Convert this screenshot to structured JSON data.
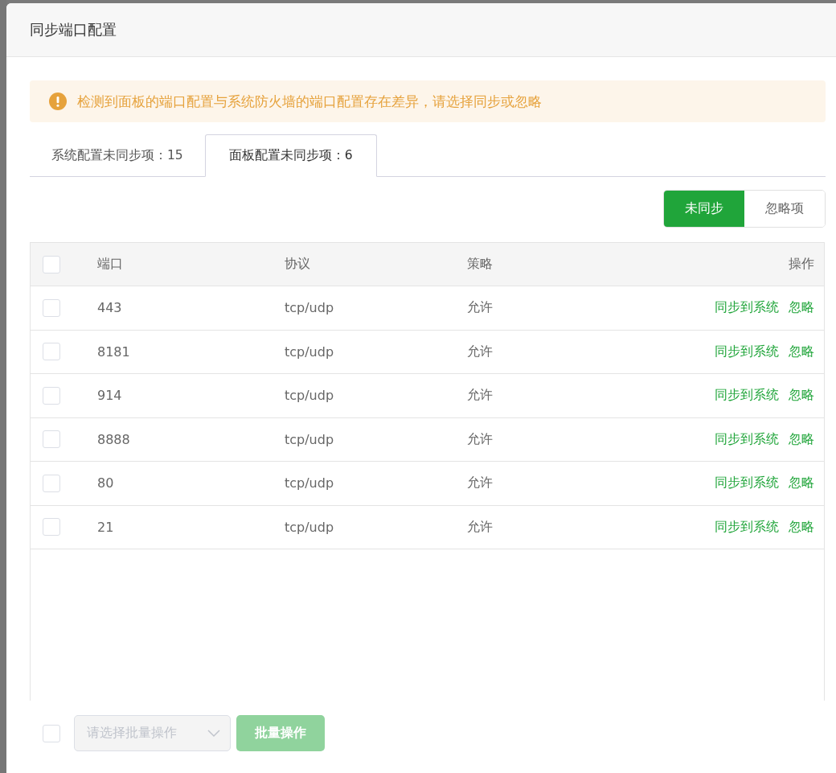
{
  "dialog": {
    "title": "同步端口配置"
  },
  "alert": {
    "text": "检测到面板的端口配置与系统防火墙的端口配置存在差异，请选择同步或忽略"
  },
  "tabs": [
    {
      "label": "系统配置未同步项：15",
      "selected": false
    },
    {
      "label": "面板配置未同步项：6",
      "selected": true
    }
  ],
  "filter": [
    {
      "label": "未同步",
      "selected": true
    },
    {
      "label": "忽略项",
      "selected": false
    }
  ],
  "table": {
    "select_all": {
      "checked": false
    },
    "columns": [
      "端口",
      "协议",
      "策略",
      "操作"
    ],
    "rows": [
      {
        "checked": false,
        "port": "443",
        "protocol": "tcp/udp",
        "policy": "允许",
        "actions": [
          "同步到系统",
          "忽略"
        ]
      },
      {
        "checked": false,
        "port": "8181",
        "protocol": "tcp/udp",
        "policy": "允许",
        "actions": [
          "同步到系统",
          "忽略"
        ]
      },
      {
        "checked": false,
        "port": "914",
        "protocol": "tcp/udp",
        "policy": "允许",
        "actions": [
          "同步到系统",
          "忽略"
        ]
      },
      {
        "checked": false,
        "port": "8888",
        "protocol": "tcp/udp",
        "policy": "允许",
        "actions": [
          "同步到系统",
          "忽略"
        ]
      },
      {
        "checked": false,
        "port": "80",
        "protocol": "tcp/udp",
        "policy": "允许",
        "actions": [
          "同步到系统",
          "忽略"
        ]
      },
      {
        "checked": false,
        "port": "21",
        "protocol": "tcp/udp",
        "policy": "允许",
        "actions": [
          "同步到系统",
          "忽略"
        ]
      }
    ]
  },
  "footer": {
    "checked": false,
    "select": {
      "placeholder": "请选择批量操作"
    },
    "button": {
      "label": "批量操作",
      "disabled": true
    }
  }
}
